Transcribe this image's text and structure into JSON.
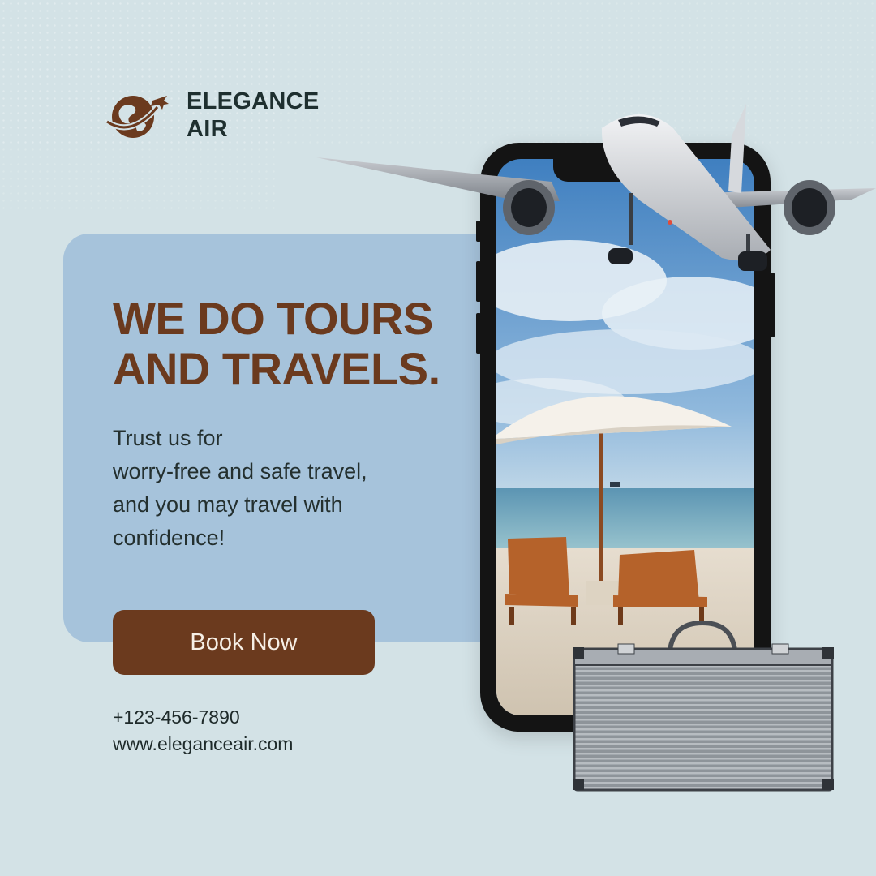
{
  "brand": {
    "name_line1": "ELEGANCE",
    "name_line2": "AIR"
  },
  "hero": {
    "headline_line1": "WE DO TOURS",
    "headline_line2": "AND TRAVELS.",
    "tagline_line1": "Trust us for",
    "tagline_line2": "worry-free and safe travel,",
    "tagline_line3": "and you may travel with",
    "tagline_line4": "confidence!"
  },
  "cta": {
    "label": "Book Now"
  },
  "contact": {
    "phone": "+123-456-7890",
    "website": "www.eleganceair.com"
  },
  "colors": {
    "background": "#d3e2e6",
    "panel": "#a6c3db",
    "accent_brown": "#6b3a1e",
    "text_dark": "#24302f"
  },
  "icons": {
    "logo": "globe-with-airplane-icon",
    "phone_device": "smartphone-illustration",
    "airplane": "airplane-illustration",
    "suitcase": "suitcase-illustration"
  }
}
